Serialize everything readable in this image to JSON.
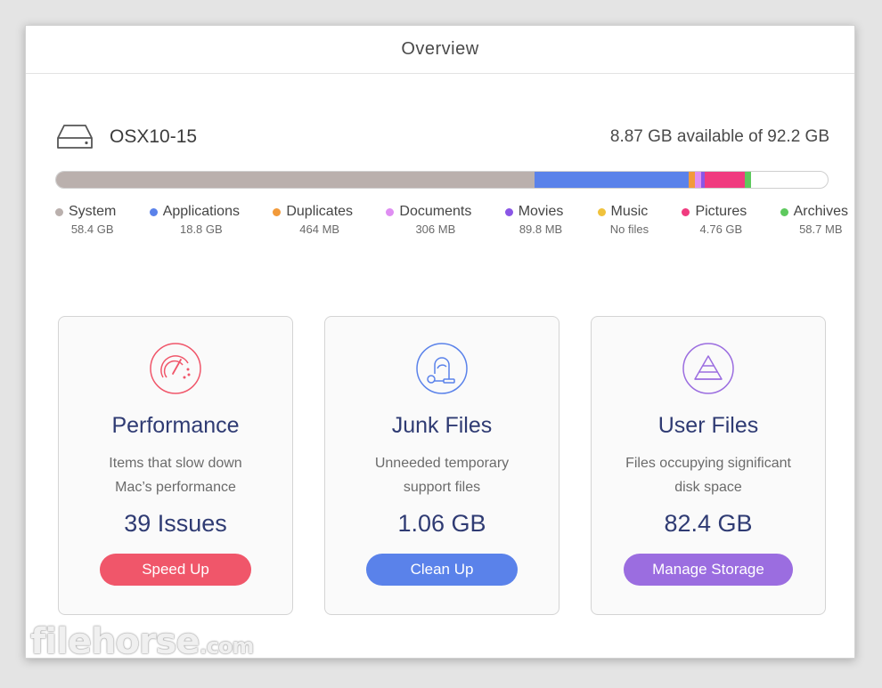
{
  "window": {
    "title": "Overview"
  },
  "disk": {
    "icon": "hard-drive-icon",
    "name": "OSX10-15",
    "available": "8.87 GB available of 92.2 GB"
  },
  "storage_bar": [
    {
      "name": "System",
      "fraction": 0.62,
      "color": "#bab0ad"
    },
    {
      "name": "Applications",
      "fraction": 0.2,
      "color": "#5a82ea"
    },
    {
      "name": "Duplicates",
      "fraction": 0.008,
      "color": "#f29a3a"
    },
    {
      "name": "Documents",
      "fraction": 0.008,
      "color": "#df8ef2"
    },
    {
      "name": "Movies",
      "fraction": 0.005,
      "color": "#8a56e6"
    },
    {
      "name": "Music",
      "fraction": 0.0,
      "color": "#f0c23c"
    },
    {
      "name": "Pictures",
      "fraction": 0.052,
      "color": "#f03b7f"
    },
    {
      "name": "Archives",
      "fraction": 0.008,
      "color": "#5ec95e"
    }
  ],
  "legend": [
    {
      "label": "System",
      "size": "58.4 GB",
      "color": "#bab0ad"
    },
    {
      "label": "Applications",
      "size": "18.8 GB",
      "color": "#5a82ea"
    },
    {
      "label": "Duplicates",
      "size": "464 MB",
      "color": "#f29a3a"
    },
    {
      "label": "Documents",
      "size": "306 MB",
      "color": "#df8ef2"
    },
    {
      "label": "Movies",
      "size": "89.8 MB",
      "color": "#8a56e6"
    },
    {
      "label": "Music",
      "size": "No files",
      "color": "#f0c23c"
    },
    {
      "label": "Pictures",
      "size": "4.76 GB",
      "color": "#f03b7f"
    },
    {
      "label": "Archives",
      "size": "58.7 MB",
      "color": "#5ec95e"
    }
  ],
  "cards": [
    {
      "icon": "speedometer-icon",
      "title": "Performance",
      "desc_line1": "Items that slow down",
      "desc_line2": "Mac’s performance",
      "value": "39 Issues",
      "button": "Speed Up",
      "accent": "#f0566a"
    },
    {
      "icon": "vacuum-cleaner-icon",
      "title": "Junk Files",
      "desc_line1": "Unneeded temporary",
      "desc_line2": "support files",
      "value": "1.06 GB",
      "button": "Clean Up",
      "accent": "#5a82ea"
    },
    {
      "icon": "pyramid-icon",
      "title": "User Files",
      "desc_line1": "Files occupying significant",
      "desc_line2": "disk space",
      "value": "82.4 GB",
      "button": "Manage Storage",
      "accent": "#9b6de0"
    }
  ],
  "watermark": {
    "main": "filehorse",
    "suffix": ".com"
  }
}
